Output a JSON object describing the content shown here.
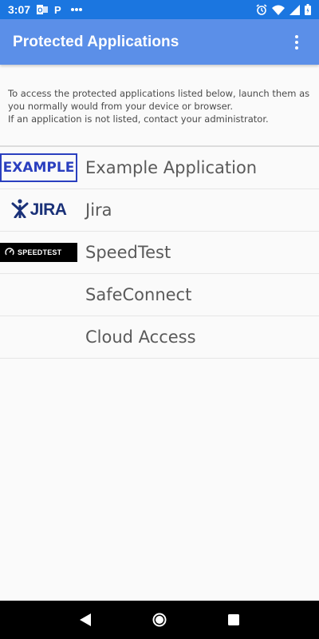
{
  "status_bar": {
    "time": "3:07",
    "icons": [
      "outlook-icon",
      "paypal-icon",
      "more-notifications-icon",
      "alarm-icon",
      "wifi-icon",
      "signal-icon",
      "battery-icon"
    ],
    "color": "#1b76e0"
  },
  "app_bar": {
    "title": "Protected Applications",
    "color": "#5b8fe8",
    "menu_icon": "more-vert-icon"
  },
  "info": {
    "line1": "To access the protected applications listed below, launch them as you normally would from your device or browser.",
    "line2": "If an application is not listed, contact your administrator."
  },
  "applications": [
    {
      "name": "Example Application",
      "logo_text": "EXAMPLE",
      "logo_color": "#2a3fbf"
    },
    {
      "name": "Jira",
      "logo_text": "JIRA",
      "logo_color": "#1a3178"
    },
    {
      "name": "SpeedTest",
      "logo_text": "SPEEDTEST",
      "logo_color": "#000000"
    },
    {
      "name": "SafeConnect",
      "logo_text": ""
    },
    {
      "name": "Cloud Access",
      "logo_text": ""
    }
  ],
  "nav_bar": {
    "buttons": [
      "back-icon",
      "home-icon",
      "recents-icon"
    ]
  }
}
